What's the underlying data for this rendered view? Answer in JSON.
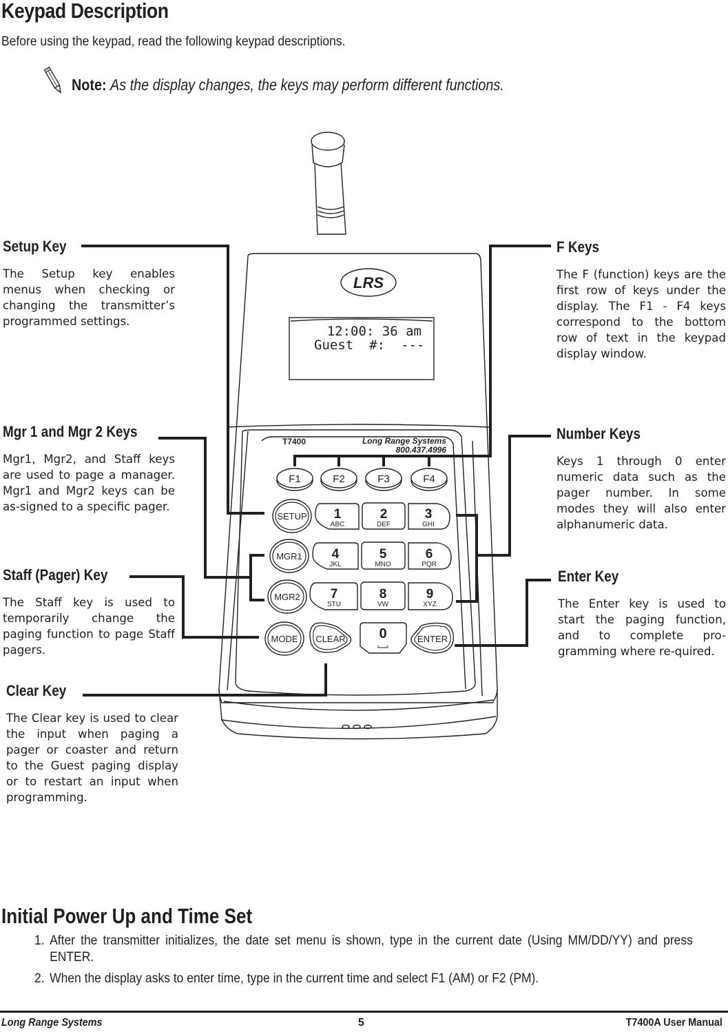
{
  "page": {
    "heading": "Keypad Description",
    "intro": "Before using the keypad, read the following keypad descriptions.",
    "note": {
      "icon": "pencil-icon",
      "label": "Note:",
      "text": "As the display changes, the keys may perform different functions."
    }
  },
  "callouts": {
    "setup": {
      "title": "Setup Key",
      "text": "The Setup key enables menus when checking or changing the transmitter’s programmed settings."
    },
    "mgr": {
      "title": "Mgr 1 and Mgr 2 Keys",
      "text": "Mgr1, Mgr2, and Staff keys are used to page a manager.  Mgr1 and Mgr2 keys can be as-signed to a specific pager."
    },
    "staff": {
      "title": "Staff (Pager) Key",
      "text": "The Staff key is used to temporarily change the paging function to page Staff pagers."
    },
    "clear": {
      "title": "Clear Key",
      "text": "The Clear key is used to clear the input when paging a pager or coaster and return to the Guest paging display or to restart an input when programming."
    },
    "fkeys": {
      "title": "F Keys",
      "text": "The F (function) keys are the first row of keys under the display.  The F1 - F4 keys correspond to the bottom row of text in the keypad display window."
    },
    "number": {
      "title": "Number Keys",
      "text": "Keys 1 through 0 enter numeric data such as the pager number.  In some modes they will also enter alphanumeric data."
    },
    "enter": {
      "title": "Enter Key",
      "text": "The Enter key is used to start the paging function, and to complete pro-gramming where re-quired."
    }
  },
  "device": {
    "logo": "LRS",
    "display": {
      "line1": "12:00: 36 am",
      "line2": "Guest  #:  ---"
    },
    "model": "T7400",
    "brand": "Long Range Systems",
    "phone": "800.437.4996",
    "fkeys": [
      "F1",
      "F2",
      "F3",
      "F4"
    ],
    "side_keys": [
      "SETUP",
      "MGR1",
      "MGR2",
      "MODE"
    ],
    "number_keys": [
      {
        "digit": "1",
        "letters": "ABC"
      },
      {
        "digit": "2",
        "letters": "DEF"
      },
      {
        "digit": "3",
        "letters": "GHI"
      },
      {
        "digit": "4",
        "letters": "JKL"
      },
      {
        "digit": "5",
        "letters": "MNO"
      },
      {
        "digit": "6",
        "letters": "PQR"
      },
      {
        "digit": "7",
        "letters": "STU"
      },
      {
        "digit": "8",
        "letters": "VW"
      },
      {
        "digit": "9",
        "letters": "XYZ"
      },
      {
        "digit": "0",
        "letters": "␣"
      }
    ],
    "clear_key": "CLEAR",
    "enter_key": "ENTER"
  },
  "power_up": {
    "heading": "Initial Power Up and Time Set",
    "steps": [
      {
        "num": "1.",
        "text": "After the transmitter initializes, the date set menu is shown, type in the current date (Using MM/DD/YY) and press ENTER."
      },
      {
        "num": "2.",
        "text": "When the display asks to enter time, type in the current time and select F1 (AM) or F2 (PM)."
      }
    ]
  },
  "footer": {
    "left": "Long Range Systems",
    "page_number": "5",
    "right": "T7400A User Manual"
  }
}
